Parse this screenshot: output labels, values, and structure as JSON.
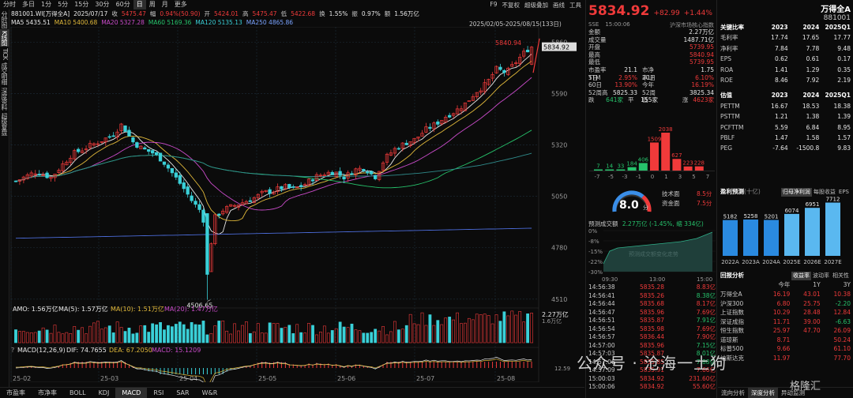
{
  "toolbar": {
    "tabs": [
      "分时",
      "多日",
      "1分",
      "5分",
      "15分",
      "30分",
      "60分",
      "日",
      "周",
      "月",
      "更多"
    ],
    "active_index": 7,
    "right": [
      "F9",
      "不复权",
      "超级叠加",
      "画线",
      "工具"
    ]
  },
  "vtabs": [
    "分时图",
    "K线图",
    "TICK",
    "成交明细",
    "深度资料",
    "超级复盘"
  ],
  "vtabs_active": 1,
  "info1": {
    "code": "881001.WI[万得全A]",
    "date": "2025/07/17",
    "close_label": "收",
    "close": "5475.47",
    "amp_label": "幅",
    "amp": "0.94%(50.90)",
    "open_label": "开",
    "open": "5424.01",
    "high_label": "高",
    "high": "5475.47",
    "low_label": "低",
    "low": "5422.68",
    "turnover_label": "换",
    "turnover": "1.55%",
    "swing_label": "振",
    "swing": "0.97%",
    "amount_label": "额",
    "amount": "1.56万亿"
  },
  "info2": {
    "ma5": "MA5 5435.51",
    "ma10": "MA10 5400.68",
    "ma20": "MA20 5327.28",
    "ma60": "MA60 5169.36",
    "ma120": "MA120 5135.13",
    "ma250": "MA250 4865.86"
  },
  "daterange": "2025/02/05-2025/08/15(133日)",
  "chart": {
    "price_axis": [
      "5860",
      "5590",
      "5320",
      "5050",
      "4780",
      "4510"
    ],
    "max_label": "5840.94",
    "min_label": "4506.65",
    "last_label": "5834.92",
    "x_labels": [
      "25-02",
      "25-03",
      "25-04",
      "25-05",
      "25-06",
      "25-07",
      "25-08"
    ],
    "amo_line": "AMO: 1.56万亿",
    "amo_ma5": "MA(5): 1.57万亿",
    "amo_ma10": "MA(10): 1.51万亿",
    "amo_ma20": "MA(20): 1.47万亿",
    "amo_axis_top": "2.27万亿",
    "amo_axis_mid": "1.6万亿",
    "macd_line": "MACD(12,26,9)",
    "macd_dif": "DIF: 74.7655",
    "macd_dea": "DEA: 67.2050",
    "macd_val": "MACD: 15.1209",
    "macd_axis": "12.59",
    "macd_question": "?"
  },
  "bottom_tabs": [
    "市盈率",
    "市净率",
    "BOLL",
    "KDJ",
    "MACD",
    "RSI",
    "SAR",
    "W&R"
  ],
  "bottom_active": 4,
  "quote": {
    "price": "5834.92",
    "change": "+82.99",
    "pct": "+1.44%",
    "sub1": "SSE",
    "sub2": "15:00:06",
    "sub3": "沪深市场核心指数",
    "rows1": [
      {
        "k": "金额",
        "v": "2.27万亿",
        "c": "white"
      },
      {
        "k": "成交量",
        "v": "1487.71亿",
        "c": "white"
      },
      {
        "k": "开盘",
        "v": "5739.95",
        "c": "red"
      },
      {
        "k": "最高",
        "v": "5840.94",
        "c": "red"
      },
      {
        "k": "最低",
        "v": "5739.95",
        "c": "red"
      }
    ],
    "rows2": [
      {
        "a": "市盈率TTM",
        "b": "21.1",
        "c": "市净率LF",
        "d": "1.75",
        "bc": "white",
        "dc": "white"
      },
      {
        "a": "5日",
        "b": "2.95%",
        "c": "20日",
        "d": "6.10%",
        "bc": "red",
        "dc": "red"
      },
      {
        "a": "60日",
        "b": "13.90%",
        "c": "今年",
        "d": "16.19%",
        "bc": "red",
        "dc": "red"
      },
      {
        "a": "52周高",
        "b": "5825.33",
        "c": "52周低",
        "d": "3825.34",
        "bc": "white",
        "dc": "white"
      },
      {
        "a": "跌",
        "b": "641家",
        "c": "平",
        "d": "155家",
        "bc": "green",
        "dc": "white"
      }
    ],
    "rise_label": "涨",
    "rise_count": "4623家",
    "dist_values": [
      7,
      14,
      33,
      184,
      406,
      1509,
      2038,
      627,
      223,
      228
    ],
    "dist_labels": [
      "7",
      "14",
      "33",
      "184",
      "406",
      "1509",
      "2038",
      "627",
      "223",
      "228"
    ],
    "dist_axis": [
      "-7",
      "-5",
      "-3",
      "-1",
      "0",
      "1",
      "3",
      "5",
      "7"
    ],
    "gauge_score": "8.0",
    "gauge_unit": "分",
    "tech_label": "技术面",
    "tech_score": "8.5分",
    "fund_label": "资金面",
    "fund_score": "7.5分",
    "flow_title": "预测成交额",
    "flow_value": "2.27万亿 (-1.45%, 缩 334亿)",
    "flow_axis": [
      "0%",
      "-8%",
      "-15%",
      "-22%",
      "-30%"
    ],
    "flow_watermark": "预测成交额变化走势",
    "flow_times": [
      "09:30",
      "13:00",
      "15:00"
    ],
    "ticks": [
      {
        "t": "14:56:38",
        "p": "5835.28",
        "a": "8.83亿",
        "ac": "red"
      },
      {
        "t": "14:56:41",
        "p": "5835.26",
        "a": "8.38亿",
        "ac": "green"
      },
      {
        "t": "14:56:44",
        "p": "5835.68",
        "a": "8.17亿",
        "ac": "red"
      },
      {
        "t": "14:56:47",
        "p": "5835.96",
        "a": "7.69亿",
        "ac": "red"
      },
      {
        "t": "14:56:51",
        "p": "5835.87",
        "a": "7.91亿",
        "ac": "green"
      },
      {
        "t": "14:56:54",
        "p": "5835.98",
        "a": "7.69亿",
        "ac": "red"
      },
      {
        "t": "14:56:57",
        "p": "5836.44",
        "a": "7.90亿",
        "ac": "red"
      },
      {
        "t": "14:57:00",
        "p": "5835.96",
        "a": "7.15亿",
        "ac": "green"
      },
      {
        "t": "14:57:03",
        "p": "5835.87",
        "a": "8.01亿",
        "ac": "green"
      },
      {
        "t": "14:57:06",
        "p": "5835.85",
        "a": "7.88亿",
        "ac": "green"
      },
      {
        "t": "14:57:09",
        "p": "5835.91",
        "a": "7.66亿",
        "ac": "red"
      },
      {
        "t": "15:00:03",
        "p": "5834.92",
        "a": "231.60亿",
        "ac": "red"
      },
      {
        "t": "15:00:06",
        "p": "5834.92",
        "a": "55.60亿",
        "ac": "red"
      }
    ]
  },
  "fund": {
    "name": "万得全A",
    "code": "881001",
    "kpi_title": "关键比率",
    "kpi_years": [
      "2023",
      "2024",
      "2025Q1"
    ],
    "kpi_rows": [
      {
        "k": "毛利率",
        "v": [
          "17.74",
          "17.65",
          "17.77"
        ]
      },
      {
        "k": "净利率",
        "v": [
          "7.84",
          "7.78",
          "9.48"
        ]
      },
      {
        "k": "EPS",
        "v": [
          "0.62",
          "0.61",
          "0.17"
        ]
      },
      {
        "k": "ROA",
        "v": [
          "1.41",
          "1.29",
          "0.35"
        ]
      },
      {
        "k": "ROE",
        "v": [
          "8.46",
          "7.92",
          "2.19"
        ]
      }
    ],
    "val_title": "估值",
    "val_years": [
      "2023",
      "2024",
      "2025Q1"
    ],
    "val_rows": [
      {
        "k": "PETTM",
        "v": [
          "16.67",
          "18.53",
          "18.38"
        ]
      },
      {
        "k": "PSTTM",
        "v": [
          "1.21",
          "1.38",
          "1.39"
        ]
      },
      {
        "k": "PCFTTM",
        "v": [
          "5.59",
          "6.84",
          "8.95"
        ]
      },
      {
        "k": "PBLF",
        "v": [
          "1.47",
          "1.58",
          "1.57"
        ]
      },
      {
        "k": "PEG",
        "v": [
          "-7.64",
          "-1500.8",
          "9.83"
        ]
      }
    ],
    "fc_title": "盈利预测",
    "fc_unit": "(十亿)",
    "fc_pills": [
      "归母净利润",
      "每股收益",
      "EPS"
    ],
    "fc_values": [
      5182,
      5258,
      5201,
      6074,
      6951,
      7712
    ],
    "fc_labels": [
      "5182",
      "5258",
      "5201",
      "6074",
      "6951",
      "7712"
    ],
    "fc_years": [
      "2022A",
      "2023A",
      "2024A",
      "2025E",
      "2026E",
      "2027E"
    ],
    "ret_title": "回报分析",
    "ret_pills": [
      "收益率",
      "波动率",
      "相关性"
    ],
    "ret_cols": [
      "今年",
      "1Y",
      "3Y"
    ],
    "ret_rows": [
      {
        "k": "万得全A",
        "v": [
          "16.19",
          "43.01",
          "10.38"
        ],
        "c": [
          "red",
          "red",
          "red"
        ]
      },
      {
        "k": "沪深300",
        "v": [
          "6.80",
          "25.75",
          "-2.20"
        ],
        "c": [
          "red",
          "red",
          "green"
        ]
      },
      {
        "k": "上证指数",
        "v": [
          "10.29",
          "28.48",
          "12.84"
        ],
        "c": [
          "red",
          "red",
          "red"
        ]
      },
      {
        "k": "深证成指",
        "v": [
          "11.71",
          "39.00",
          "-6.63"
        ],
        "c": [
          "red",
          "red",
          "green"
        ]
      },
      {
        "k": "恒生指数",
        "v": [
          "25.97",
          "47.70",
          "26.09"
        ],
        "c": [
          "red",
          "red",
          "red"
        ]
      },
      {
        "k": "道琼斯",
        "v": [
          "8.71",
          "",
          "50.24"
        ],
        "c": [
          "red",
          "red",
          "red"
        ]
      },
      {
        "k": "标普500",
        "v": [
          "9.66",
          "",
          "61.10"
        ],
        "c": [
          "red",
          "red",
          "red"
        ]
      },
      {
        "k": "纳斯达克",
        "v": [
          "11.97",
          "",
          "77.70"
        ],
        "c": [
          "red",
          "red",
          "red"
        ]
      }
    ],
    "bottom_tabs": [
      "流向分析",
      "深度分析",
      "异动监测"
    ],
    "bottom_active": 1
  },
  "watermark": "公众号 · 沧海一土狗",
  "watermark_sub": "格隆汇",
  "colors": {
    "up": "#f03a3a",
    "down": "#3ad0d8",
    "green": "#26c26b",
    "ma5": "#e8e8e8",
    "ma10": "#e0b83a",
    "ma20": "#c94bc9",
    "ma60": "#26c26b",
    "ma120": "#2f8a8a",
    "ma250": "#4b6bd8"
  }
}
